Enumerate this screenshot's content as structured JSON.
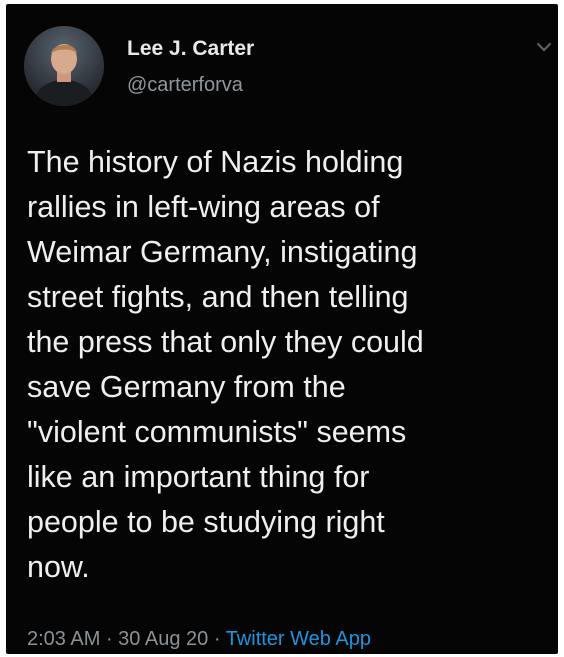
{
  "tweet": {
    "author": {
      "display_name": "Lee J. Carter",
      "handle": "@carterforva",
      "avatar_icon": "profile-photo"
    },
    "menu_icon": "chevron-down-icon",
    "text": "The history of Nazis holding\nrallies in left-wing areas of\nWeimar Germany, instigating\nstreet fights, and then telling\nthe press that only they could\nsave Germany from the\n\"violent communists\" seems\nlike an important thing for\npeople to be studying right\nnow.",
    "meta": {
      "time": "2:03 AM",
      "separator": " · ",
      "date": "30 Aug 20",
      "source": "Twitter Web App"
    },
    "colors": {
      "background": "#050505",
      "text": "#efefef",
      "muted": "#8a9197",
      "link": "#1b95e0"
    }
  }
}
